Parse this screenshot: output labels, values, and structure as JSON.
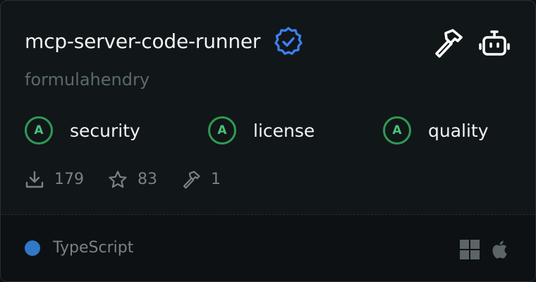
{
  "server": {
    "name": "mcp-server-code-runner",
    "author": "formulahendry",
    "verified_icon": "verified-badge-icon"
  },
  "header_icons": [
    "hammer-icon",
    "robot-icon"
  ],
  "scores": [
    {
      "grade": "A",
      "label": "security"
    },
    {
      "grade": "A",
      "label": "license"
    },
    {
      "grade": "A",
      "label": "quality"
    }
  ],
  "stats": {
    "downloads": "179",
    "stars": "83",
    "tools": "1"
  },
  "footer": {
    "language": "TypeScript",
    "language_color": "#3178c6",
    "platforms": [
      "windows-icon",
      "apple-icon"
    ]
  },
  "colors": {
    "accent_blue": "#3b82f6",
    "grade_green": "#2e9a55"
  }
}
